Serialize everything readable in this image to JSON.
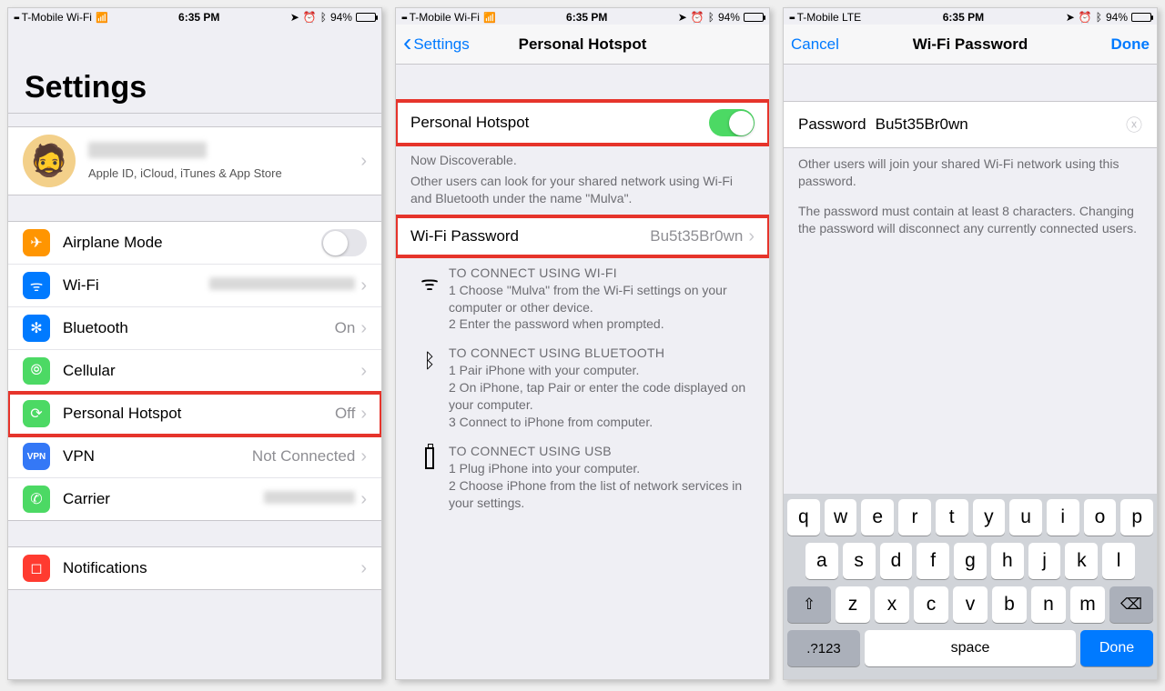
{
  "status": {
    "carrier_wifi": "T-Mobile Wi-Fi",
    "carrier_lte": "T-Mobile  LTE",
    "time": "6:35 PM",
    "battery_pct": "94%"
  },
  "screen1": {
    "title": "Settings",
    "profile_sub": "Apple ID, iCloud, iTunes & App Store",
    "rows": {
      "airplane": "Airplane Mode",
      "wifi": "Wi-Fi",
      "bluetooth": "Bluetooth",
      "bluetooth_val": "On",
      "cellular": "Cellular",
      "hotspot": "Personal Hotspot",
      "hotspot_val": "Off",
      "vpn": "VPN",
      "vpn_val": "Not Connected",
      "carrier": "Carrier",
      "notifications": "Notifications"
    }
  },
  "screen2": {
    "back": "Settings",
    "title": "Personal Hotspot",
    "toggle_label": "Personal Hotspot",
    "desc_head": "Now Discoverable.",
    "desc_body": "Other users can look for your shared network using Wi-Fi and Bluetooth under the name \"Mulva\".",
    "wifi_pwd_label": "Wi-Fi Password",
    "wifi_pwd_value": "Bu5t35Br0wn",
    "inst": {
      "wifi_hdr": "TO CONNECT USING WI-FI",
      "wifi_1": "1 Choose \"Mulva\" from the Wi-Fi settings on your computer or other device.",
      "wifi_2": "2 Enter the password when prompted.",
      "bt_hdr": "TO CONNECT USING BLUETOOTH",
      "bt_1": "1 Pair iPhone with your computer.",
      "bt_2": "2 On iPhone, tap Pair or enter the code displayed on your computer.",
      "bt_3": "3 Connect to iPhone from computer.",
      "usb_hdr": "TO CONNECT USING USB",
      "usb_1": "1 Plug iPhone into your computer.",
      "usb_2": "2 Choose iPhone from the list of network services in your settings."
    }
  },
  "screen3": {
    "cancel": "Cancel",
    "title": "Wi-Fi Password",
    "done": "Done",
    "pwd_label": "Password",
    "pwd_value": "Bu5t35Br0wn",
    "desc1": "Other users will join your shared Wi-Fi network using this password.",
    "desc2": "The password must contain at least 8 characters. Changing the password will disconnect any currently connected users.",
    "kb": {
      "r1": [
        "q",
        "w",
        "e",
        "r",
        "t",
        "y",
        "u",
        "i",
        "o",
        "p"
      ],
      "r2": [
        "a",
        "s",
        "d",
        "f",
        "g",
        "h",
        "j",
        "k",
        "l"
      ],
      "r3": [
        "z",
        "x",
        "c",
        "v",
        "b",
        "n",
        "m"
      ],
      "sym": ".?123",
      "space": "space",
      "done": "Done"
    }
  },
  "icons": {
    "airplane": "✈",
    "wifi": "ᯤ",
    "bluetooth": "✻",
    "cellular": "⦾",
    "hotspot": "⟳",
    "vpn": "VPN",
    "carrier": "✆",
    "notifications": "◻",
    "clear": "ⓧ",
    "shift": "⇧",
    "backspace": "⌫",
    "location": "➤",
    "alarm": "⏰",
    "bt_small": "ᛒ"
  },
  "colors": {
    "orange": "#ff9501",
    "blue": "#007aff",
    "green": "#4cd964",
    "vpn_blue": "#3478f6",
    "red": "#ff3b30"
  }
}
